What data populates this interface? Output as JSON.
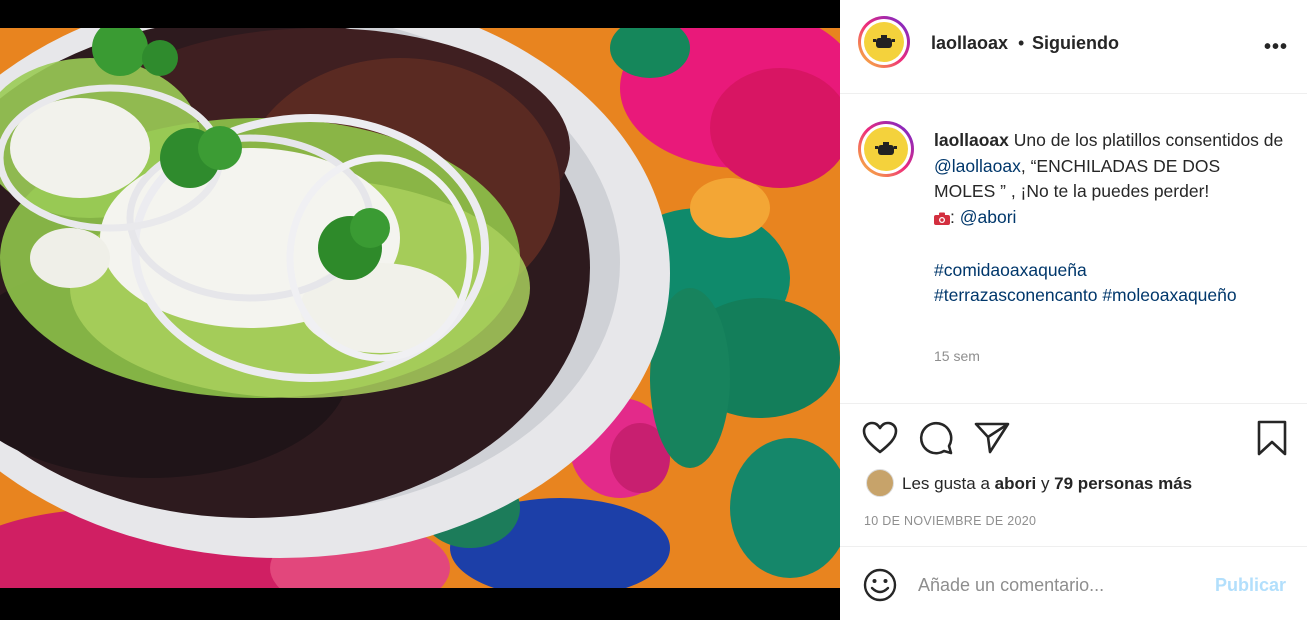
{
  "post": {
    "username": "laollaoax",
    "separator": "•",
    "follow_status": "Siguiendo",
    "more_icon": "more-horizontal-icon",
    "caption_user": "laollaoax",
    "caption_part1": "Uno de los platillos consentidos de",
    "caption_mention": "@laollaoax",
    "caption_part2": ", “ENCHILADAS DE DOS MOLES ” , ¡No te la puedes perder!",
    "photo_credit_icon": "camera-icon",
    "photo_credit_prefix": ":",
    "photo_credit": "@abori",
    "hashtag1": "#comidaoaxaqueña",
    "hashtag2": "#terrazasconencanto",
    "hashtag3": "#moleoaxaqueño",
    "time_ago": "15 sem",
    "likes_prefix": "Les gusta a",
    "likes_user": "abori",
    "likes_mid": "y",
    "likes_others": "79 personas más",
    "date": "10 DE NOVIEMBRE DE 2020",
    "comment_placeholder": "Añade un comentario...",
    "publish_label": "Publicar"
  },
  "colors": {
    "link": "#00376b",
    "muted": "#8e8e8e",
    "publish": "#b2dffc"
  }
}
